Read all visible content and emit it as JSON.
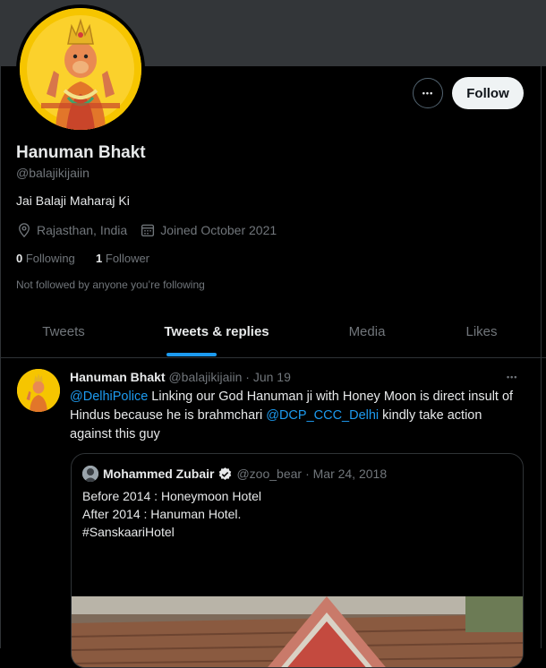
{
  "profile": {
    "name": "Hanuman Bhakt",
    "handle": "@balajikijaiin",
    "bio": "Jai Balaji Maharaj Ki",
    "location": "Rajasthan, India",
    "joined": "Joined October 2021",
    "following_count": "0",
    "following_label": "Following",
    "followers_count": "1",
    "followers_label": "Follower",
    "not_followed": "Not followed by anyone you’re following"
  },
  "actions": {
    "more": "•••",
    "follow": "Follow"
  },
  "tabs": [
    {
      "label": "Tweets"
    },
    {
      "label": "Tweets & replies"
    },
    {
      "label": "Media"
    },
    {
      "label": "Likes"
    }
  ],
  "tweet": {
    "name": "Hanuman Bhakt",
    "handle": "@balajikijaiin",
    "date": "· Jun 19",
    "more": "•••",
    "mention1": "@DelhiPolice",
    "text1": " Linking our God Hanuman ji with Honey Moon is direct insult of Hindus  because he is brahmchari ",
    "mention2": "@DCP_CCC_Delhi",
    "text2": " kindly take action against this guy",
    "quote": {
      "name": "Mohammed Zubair",
      "handle": "@zoo_bear",
      "date": "· Mar 24, 2018",
      "line1": "Before 2014 : Honeymoon Hotel",
      "line2": "After 2014 : Hanuman Hotel.",
      "line3": "#SanskaariHotel"
    }
  },
  "icons": {
    "location": "location-pin-icon",
    "calendar": "calendar-icon",
    "verified": "verified-badge-icon",
    "more": "more-dots-icon"
  },
  "colors": {
    "background": "#000000",
    "accent": "#1d9bf0",
    "muted": "#71767b",
    "text": "#e7e9ea",
    "banner": "#333639",
    "avatar_bg": "#f6c500"
  }
}
